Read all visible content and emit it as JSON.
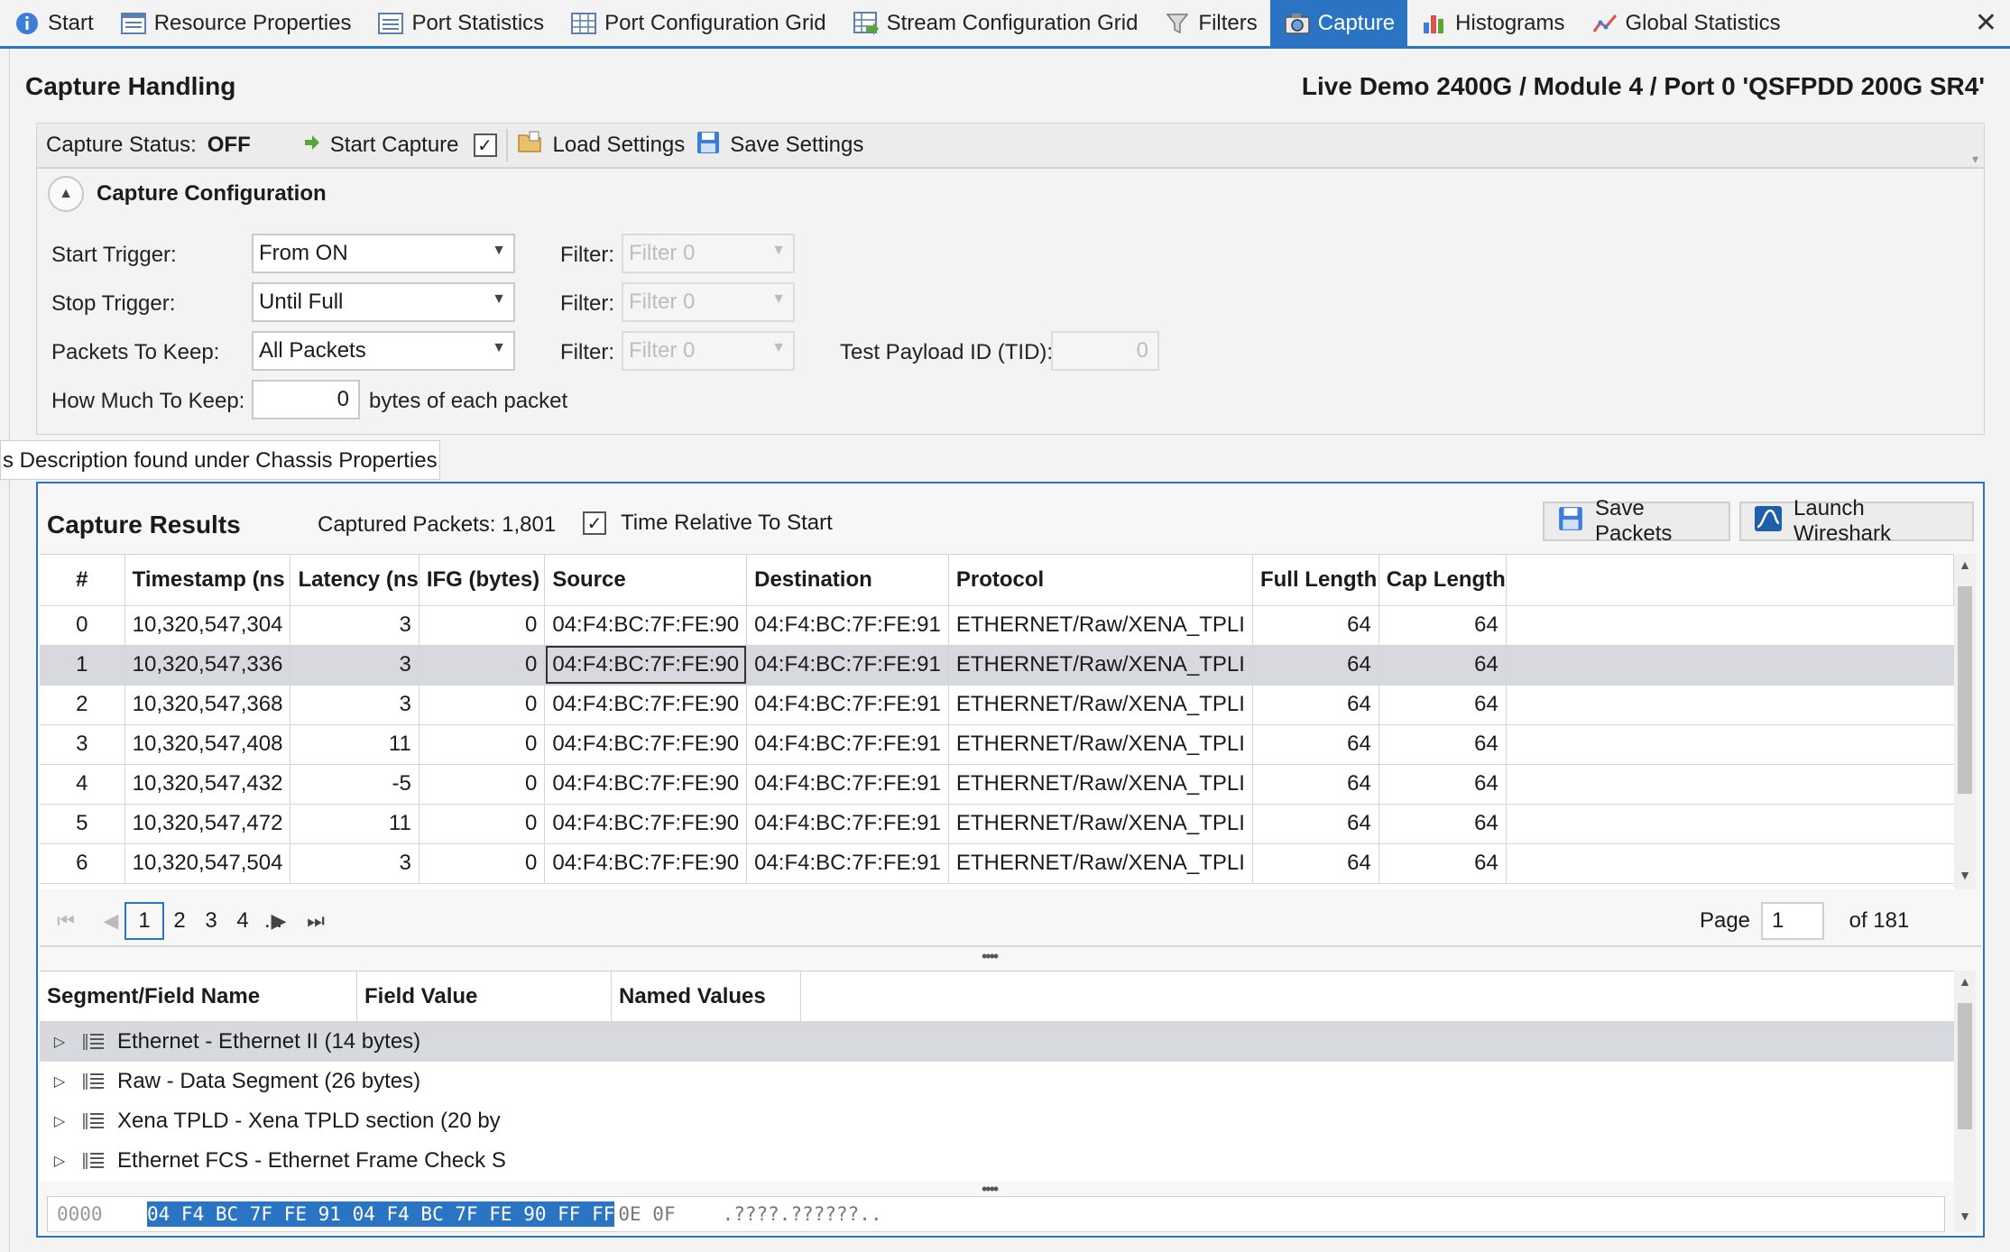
{
  "tabs": [
    {
      "label": "Start",
      "icon": "info-icon"
    },
    {
      "label": "Resource Properties",
      "icon": "properties-icon"
    },
    {
      "label": "Port Statistics",
      "icon": "statistics-icon"
    },
    {
      "label": "Port Configuration Grid",
      "icon": "grid-icon"
    },
    {
      "label": "Stream Configuration Grid",
      "icon": "stream-grid-icon"
    },
    {
      "label": "Filters",
      "icon": "filter-icon"
    },
    {
      "label": "Capture",
      "icon": "camera-icon",
      "active": true
    },
    {
      "label": "Histograms",
      "icon": "histogram-icon"
    },
    {
      "label": "Global Statistics",
      "icon": "chart-line-icon"
    }
  ],
  "header": {
    "title": "Capture Handling",
    "path": "Live Demo 2400G / Module 4 / Port 0 'QSFPDD 200G SR4'"
  },
  "toolbar": {
    "status_label": "Capture Status:",
    "status_value": "OFF",
    "start_capture": "Start Capture",
    "load_settings": "Load Settings",
    "save_settings": "Save Settings"
  },
  "config": {
    "title": "Capture Configuration",
    "start_trigger_label": "Start Trigger:",
    "start_trigger_value": "From ON",
    "stop_trigger_label": "Stop Trigger:",
    "stop_trigger_value": "Until Full",
    "packets_keep_label": "Packets To Keep:",
    "packets_keep_value": "All Packets",
    "how_much_label": "How Much To Keep:",
    "how_much_value": "0",
    "how_much_suffix": "bytes of each packet",
    "filter_label": "Filter:",
    "filter_value": "Filter  0",
    "tid_label": "Test Payload ID (TID):",
    "tid_value": "0"
  },
  "tooltip": "s Description found under Chassis Properties.",
  "results": {
    "title": "Capture Results",
    "captured_label": "Captured Packets: 1,801",
    "time_relative_label": "Time Relative To Start",
    "save_packets": "Save Packets",
    "launch_wireshark": "Launch Wireshark",
    "columns": [
      "#",
      "Timestamp (ns",
      "Latency (ns",
      "IFG (bytes)",
      "Source",
      "Destination",
      "Protocol",
      "Full Length",
      "Cap Length"
    ],
    "rows": [
      [
        "0",
        "10,320,547,304",
        "3",
        "0",
        "04:F4:BC:7F:FE:90",
        "04:F4:BC:7F:FE:91",
        "ETHERNET/Raw/XENA_TPLI",
        "64",
        "64"
      ],
      [
        "1",
        "10,320,547,336",
        "3",
        "0",
        "04:F4:BC:7F:FE:90",
        "04:F4:BC:7F:FE:91",
        "ETHERNET/Raw/XENA_TPLI",
        "64",
        "64"
      ],
      [
        "2",
        "10,320,547,368",
        "3",
        "0",
        "04:F4:BC:7F:FE:90",
        "04:F4:BC:7F:FE:91",
        "ETHERNET/Raw/XENA_TPLI",
        "64",
        "64"
      ],
      [
        "3",
        "10,320,547,408",
        "11",
        "0",
        "04:F4:BC:7F:FE:90",
        "04:F4:BC:7F:FE:91",
        "ETHERNET/Raw/XENA_TPLI",
        "64",
        "64"
      ],
      [
        "4",
        "10,320,547,432",
        "-5",
        "0",
        "04:F4:BC:7F:FE:90",
        "04:F4:BC:7F:FE:91",
        "ETHERNET/Raw/XENA_TPLI",
        "64",
        "64"
      ],
      [
        "5",
        "10,320,547,472",
        "11",
        "0",
        "04:F4:BC:7F:FE:90",
        "04:F4:BC:7F:FE:91",
        "ETHERNET/Raw/XENA_TPLI",
        "64",
        "64"
      ],
      [
        "6",
        "10,320,547,504",
        "3",
        "0",
        "04:F4:BC:7F:FE:90",
        "04:F4:BC:7F:FE:91",
        "ETHERNET/Raw/XENA_TPLI",
        "64",
        "64"
      ]
    ],
    "selected_row": 1
  },
  "pager": {
    "pages": [
      "1",
      "2",
      "3",
      "4",
      "..."
    ],
    "current": "1",
    "page_label": "Page",
    "page_value": "1",
    "of_label": "of 181"
  },
  "detail": {
    "columns": [
      "Segment/Field Name",
      "Field Value",
      "Named Values"
    ],
    "items": [
      "Ethernet - Ethernet II (14 bytes)",
      "Raw - Data Segment (26 bytes)",
      "Xena TPLD - Xena TPLD section (20 by",
      "Ethernet FCS - Ethernet Frame Check S"
    ]
  },
  "hex": {
    "offset": "0000",
    "highlighted": "04 F4 BC 7F FE 91 04 F4 BC 7F FE 90 FF FF",
    "rest": "0E 0F",
    "ascii": ".????.??????.."
  },
  "colors": {
    "accent": "#2b74c4",
    "selected_row": "#d8d8df"
  }
}
